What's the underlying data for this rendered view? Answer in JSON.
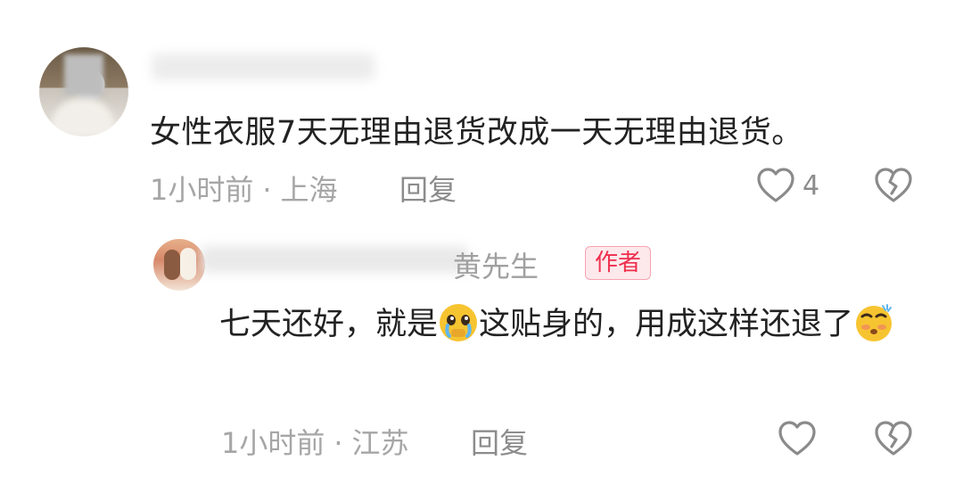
{
  "main_comment": {
    "author": "",
    "text": "女性衣服7天无理由退货改成一天无理由退货。",
    "time": "1小时前",
    "location": "上海",
    "reply_label": "回复",
    "like_count": "4"
  },
  "reply_comment": {
    "author_visible": "黄先生",
    "badge": "作者",
    "text_part1": "七天还好，就是",
    "emoji1": "crying-face-emoji",
    "text_part2": "这贴身的，用成这样还退了",
    "emoji2": "flushed-face-emoji",
    "time": "1小时前",
    "location": "江苏",
    "reply_label": "回复"
  },
  "icons": {
    "like": "heart-outline-icon",
    "dislike": "broken-heart-icon"
  },
  "colors": {
    "badge_text": "#ee2f4d",
    "badge_bg": "#fde9ec",
    "meta": "#a6a6a6"
  }
}
